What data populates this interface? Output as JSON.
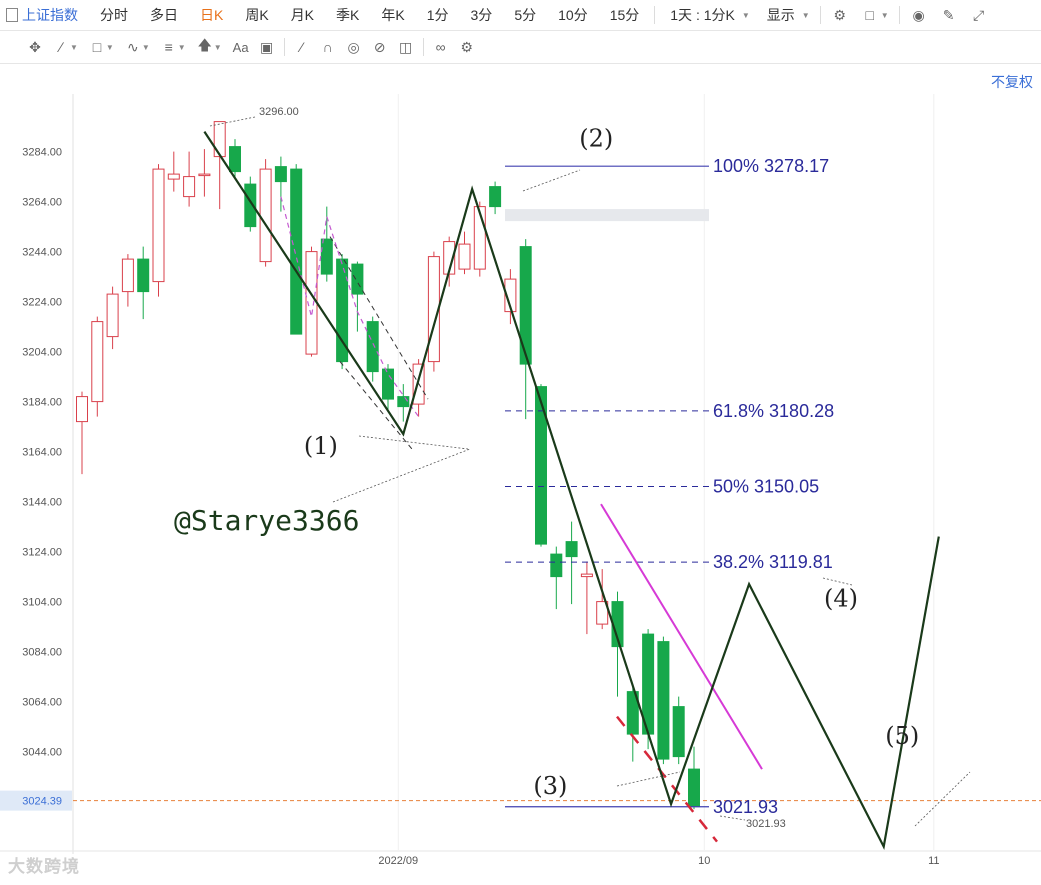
{
  "toolbar": {
    "items": [
      {
        "label": "上证指数",
        "state": "first"
      },
      {
        "label": "分时",
        "state": ""
      },
      {
        "label": "多日",
        "state": ""
      },
      {
        "label": "日K",
        "state": "active"
      },
      {
        "label": "周K",
        "state": ""
      },
      {
        "label": "月K",
        "state": ""
      },
      {
        "label": "季K",
        "state": ""
      },
      {
        "label": "年K",
        "state": ""
      },
      {
        "label": "1分",
        "state": ""
      },
      {
        "label": "3分",
        "state": ""
      },
      {
        "label": "5分",
        "state": ""
      },
      {
        "label": "10分",
        "state": ""
      },
      {
        "label": "15分",
        "state": ""
      }
    ],
    "period_select": "1天 : 1分K",
    "display_label": "显示",
    "right_icons": [
      "gear-icon",
      "square-icon",
      "camera-icon",
      "pencil-icon",
      "fullscreen-icon"
    ]
  },
  "drawing_tools": [
    "cross-move-icon",
    "line-icon",
    "rect-icon",
    "wave-icon",
    "text-align-icon",
    "arrow-up-icon",
    "font-icon",
    "comment-icon",
    "ruler-icon",
    "magnet-icon",
    "eye-icon",
    "eye-off-icon",
    "trash-icon",
    "link-icon",
    "settings-icon"
  ],
  "fuquan_label": "不复权",
  "watermark": "大数跨境",
  "accent_color": "#3b6fd6",
  "chart_data": {
    "type": "candlestick",
    "ylim": [
      3007,
      3310
    ],
    "yticks": [
      3284,
      3264,
      3244,
      3224,
      3204,
      3184,
      3164,
      3144,
      3124,
      3104,
      3084,
      3064,
      3044,
      3024
    ],
    "ytick_labels": [
      "3284.00",
      "3264.00",
      "3244.00",
      "3224.00",
      "3204.00",
      "3184.00",
      "3164.00",
      "3144.00",
      "3124.00",
      "3104.00",
      "3084.00",
      "3064.00",
      "3044.00"
    ],
    "xticks": [
      {
        "label": "2022/09",
        "index": 21
      },
      {
        "label": "10",
        "index": 41
      },
      {
        "label": "11",
        "index": 56
      }
    ],
    "current_price": "3024.39",
    "current_value": 3024.39,
    "candles": [
      {
        "o": 3176,
        "c": 3186,
        "h": 3188,
        "l": 3155
      },
      {
        "o": 3184,
        "c": 3216,
        "h": 3218,
        "l": 3178
      },
      {
        "o": 3210,
        "c": 3227,
        "h": 3230,
        "l": 3205
      },
      {
        "o": 3228,
        "c": 3241,
        "h": 3243,
        "l": 3222
      },
      {
        "o": 3241,
        "c": 3228,
        "h": 3246,
        "l": 3217
      },
      {
        "o": 3232,
        "c": 3277,
        "h": 3279,
        "l": 3226
      },
      {
        "o": 3273,
        "c": 3275,
        "h": 3284,
        "l": 3268
      },
      {
        "o": 3266,
        "c": 3274,
        "h": 3284,
        "l": 3262
      },
      {
        "o": 3275,
        "c": 3275,
        "h": 3285,
        "l": 3266
      },
      {
        "o": 3282,
        "c": 3296,
        "h": 3294,
        "l": 3261
      },
      {
        "o": 3286,
        "c": 3276,
        "h": 3289,
        "l": 3273
      },
      {
        "o": 3271,
        "c": 3254,
        "h": 3274,
        "l": 3252
      },
      {
        "o": 3240,
        "c": 3277,
        "h": 3281,
        "l": 3238
      },
      {
        "o": 3278,
        "c": 3272,
        "h": 3282,
        "l": 3260
      },
      {
        "o": 3277,
        "c": 3211,
        "h": 3279,
        "l": 3211
      },
      {
        "o": 3203,
        "c": 3244,
        "h": 3246,
        "l": 3202
      },
      {
        "o": 3249,
        "c": 3235,
        "h": 3262,
        "l": 3232
      },
      {
        "o": 3241,
        "c": 3200,
        "h": 3243,
        "l": 3197
      },
      {
        "o": 3239,
        "c": 3227,
        "h": 3240,
        "l": 3212
      },
      {
        "o": 3216,
        "c": 3196,
        "h": 3218,
        "l": 3192
      },
      {
        "o": 3197,
        "c": 3185,
        "h": 3199,
        "l": 3180
      },
      {
        "o": 3186,
        "c": 3182,
        "h": 3191,
        "l": 3176
      },
      {
        "o": 3183,
        "c": 3199,
        "h": 3201,
        "l": 3178
      },
      {
        "o": 3200,
        "c": 3242,
        "h": 3244,
        "l": 3196
      },
      {
        "o": 3235,
        "c": 3248,
        "h": 3250,
        "l": 3230
      },
      {
        "o": 3237,
        "c": 3247,
        "h": 3252,
        "l": 3235
      },
      {
        "o": 3237,
        "c": 3262,
        "h": 3264,
        "l": 3234
      },
      {
        "o": 3270,
        "c": 3262,
        "h": 3272,
        "l": 3259
      },
      {
        "o": 3220,
        "c": 3233,
        "h": 3237,
        "l": 3215
      },
      {
        "o": 3246,
        "c": 3199,
        "h": 3249,
        "l": 3177
      },
      {
        "o": 3190,
        "c": 3127,
        "h": 3191,
        "l": 3126
      },
      {
        "o": 3123,
        "c": 3114,
        "h": 3126,
        "l": 3101
      },
      {
        "o": 3128,
        "c": 3122,
        "h": 3136,
        "l": 3103
      },
      {
        "o": 3114,
        "c": 3115,
        "h": 3120,
        "l": 3091
      },
      {
        "o": 3095,
        "c": 3104,
        "h": 3117,
        "l": 3093
      },
      {
        "o": 3104,
        "c": 3086,
        "h": 3108,
        "l": 3066
      },
      {
        "o": 3068,
        "c": 3051,
        "h": 3071,
        "l": 3040
      },
      {
        "o": 3091,
        "c": 3051,
        "h": 3093,
        "l": 3045
      },
      {
        "o": 3088,
        "c": 3041,
        "h": 3090,
        "l": 3039
      },
      {
        "o": 3062,
        "c": 3042,
        "h": 3066,
        "l": 3039
      },
      {
        "o": 3037,
        "c": 3022,
        "h": 3046,
        "l": 3021
      }
    ],
    "annotations": {
      "high_label": "3296.00",
      "low_label": "3021.93",
      "low_value": 3021.93,
      "wave_labels": [
        {
          "text": "(1)",
          "index": 14.5,
          "value": 3163
        },
        {
          "text": "(2)",
          "index": 32.5,
          "value": 3286
        },
        {
          "text": "(3)",
          "index": 29.5,
          "value": 3027
        },
        {
          "text": "(4)",
          "index": 48.5,
          "value": 3102
        },
        {
          "text": "(5)",
          "index": 52.5,
          "value": 3047
        }
      ],
      "wave_path": [
        {
          "index": 8,
          "value": 3292
        },
        {
          "index": 21,
          "value": 3171
        },
        {
          "index": 25.5,
          "value": 3269
        },
        {
          "index": 38.5,
          "value": 3023
        },
        {
          "index": 43.6,
          "value": 3111
        },
        {
          "index": 52.4,
          "value": 3006
        },
        {
          "index": 56,
          "value": 3130
        }
      ],
      "fib_levels": [
        {
          "label": "100% 3278.17",
          "value": 3278.17,
          "solid": true
        },
        {
          "label": "61.8% 3180.28",
          "value": 3180.28,
          "solid": false
        },
        {
          "label": "50% 3150.05",
          "value": 3150.05,
          "solid": false
        },
        {
          "label": "38.2% 3119.81",
          "value": 3119.81,
          "solid": false
        },
        {
          "label": "3021.93",
          "value": 3021.93,
          "solid": true
        }
      ],
      "handle": "@Starye3366"
    }
  }
}
